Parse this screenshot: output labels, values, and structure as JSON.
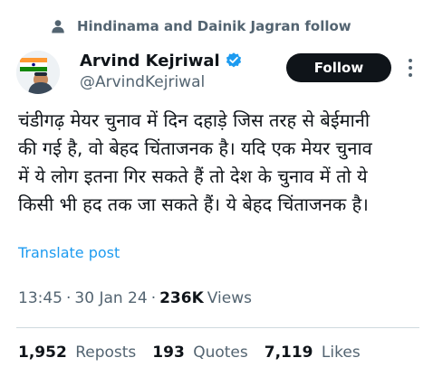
{
  "social_context": {
    "text": "Hindinama and Dainik Jagran follow",
    "icon": "person-icon"
  },
  "author": {
    "name": "Arvind Kejriwal",
    "handle": "@ArvindKejriwal",
    "verified": true,
    "verified_color": "#1d9bf0"
  },
  "follow_label": "Follow",
  "tweet_lines": [
    "चंडीगढ़ मेयर चुनाव में दिन दहाड़े जिस तरह से बेईमानी",
    "की गई है, वो बेहद चिंताजनक है। यदि एक मेयर चुनाव",
    "में ये लोग इतना गिर सकते हैं तो देश के चुनाव में तो ये",
    "किसी भी हद तक जा सकते हैं। ये बेहद चिंताजनक है।"
  ],
  "translate_label": "Translate post",
  "meta": {
    "time": "13:45",
    "date": "30 Jan 24",
    "views_count": "236K",
    "views_label": "Views"
  },
  "stats": [
    {
      "count": "1,952",
      "label": "Reposts"
    },
    {
      "count": "193",
      "label": "Quotes"
    },
    {
      "count": "7,119",
      "label": "Likes"
    }
  ],
  "colors": {
    "link": "#1d9bf0",
    "secondary_text": "#536471",
    "primary_text": "#0f1419"
  }
}
